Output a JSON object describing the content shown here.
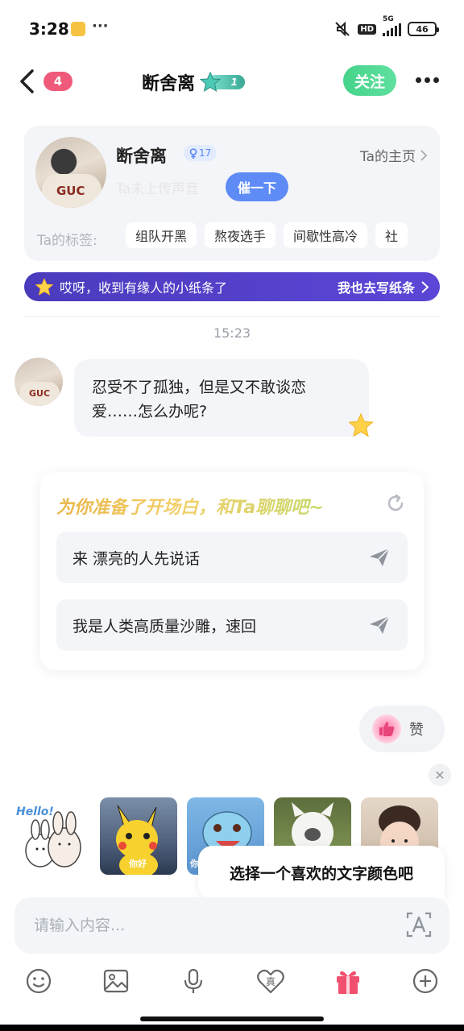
{
  "status_bar": {
    "time": "3:28",
    "more": "···",
    "hd": "HD",
    "network": "5G",
    "battery": "46"
  },
  "header": {
    "unread_count": "4",
    "title": "断舍离",
    "level": "1",
    "follow_label": "关注"
  },
  "profile": {
    "name": "断舍离",
    "badge": "17",
    "home_link": "Ta的主页",
    "voice_status": "Ta未上传声音",
    "nudge_label": "催一下",
    "tags_label": "Ta的标签:",
    "tags": [
      "组队开黑",
      "熬夜选手",
      "间歇性高冷",
      "社"
    ],
    "avatar_logo": "GUC"
  },
  "note_banner": {
    "text": "哎呀，收到有缘人的小纸条了",
    "action": "我也去写纸条"
  },
  "chat": {
    "timestamp": "15:23",
    "message": "忍受不了孤独，但是又不敢谈恋爱……怎么办呢?"
  },
  "openers": {
    "title": "为你准备了开场白，和Ta聊聊吧~",
    "items": [
      "来 漂亮的人先说话",
      "我是人类高质量沙雕，速回"
    ]
  },
  "like": {
    "label": "赞"
  },
  "stickers": {
    "items": [
      {
        "name": "hello-rabbits",
        "caption": "Hello!"
      },
      {
        "name": "pikachu",
        "caption": "你好"
      },
      {
        "name": "squirtle",
        "caption": "你"
      },
      {
        "name": "meme-face",
        "caption": ""
      },
      {
        "name": "child-photo",
        "caption": ""
      }
    ]
  },
  "color_tip": "选择一个喜欢的文字颜色吧",
  "input": {
    "placeholder": "请输入内容..."
  },
  "toolbar": {
    "true_label": "真"
  },
  "colors": {
    "follow": "#46d38a",
    "nudge": "#5e8bf6",
    "banner": "#4a3bbd",
    "unread": "#f05a7a",
    "gift": "#f0506e"
  }
}
